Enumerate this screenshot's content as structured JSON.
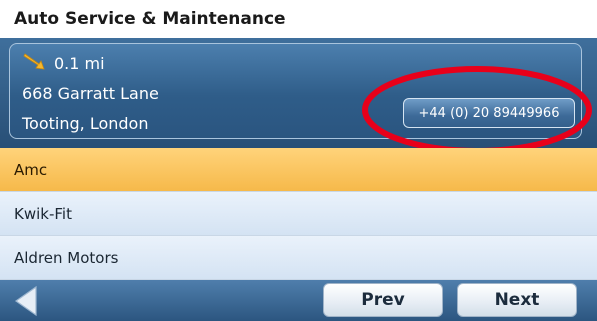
{
  "header": {
    "title": "Auto Service & Maintenance"
  },
  "details": {
    "distance": "0.1 mi",
    "direction_icon": "arrow-down-right-icon",
    "address_line1": "668 Garratt Lane",
    "address_line2": "Tooting, London",
    "phone": "+44 (0) 20 89449966",
    "annotation_color": "#e8001a"
  },
  "results": [
    {
      "label": "Amc",
      "selected": true
    },
    {
      "label": "Kwik-Fit",
      "selected": false
    },
    {
      "label": "Aldren Motors",
      "selected": false
    }
  ],
  "footer": {
    "back_icon": "triangle-left-icon",
    "prev_label": "Prev",
    "next_label": "Next"
  },
  "colors": {
    "selected_row": "#f6b94a",
    "panel_blue": "#2f5d89",
    "bar_blue": "#2c5680"
  }
}
